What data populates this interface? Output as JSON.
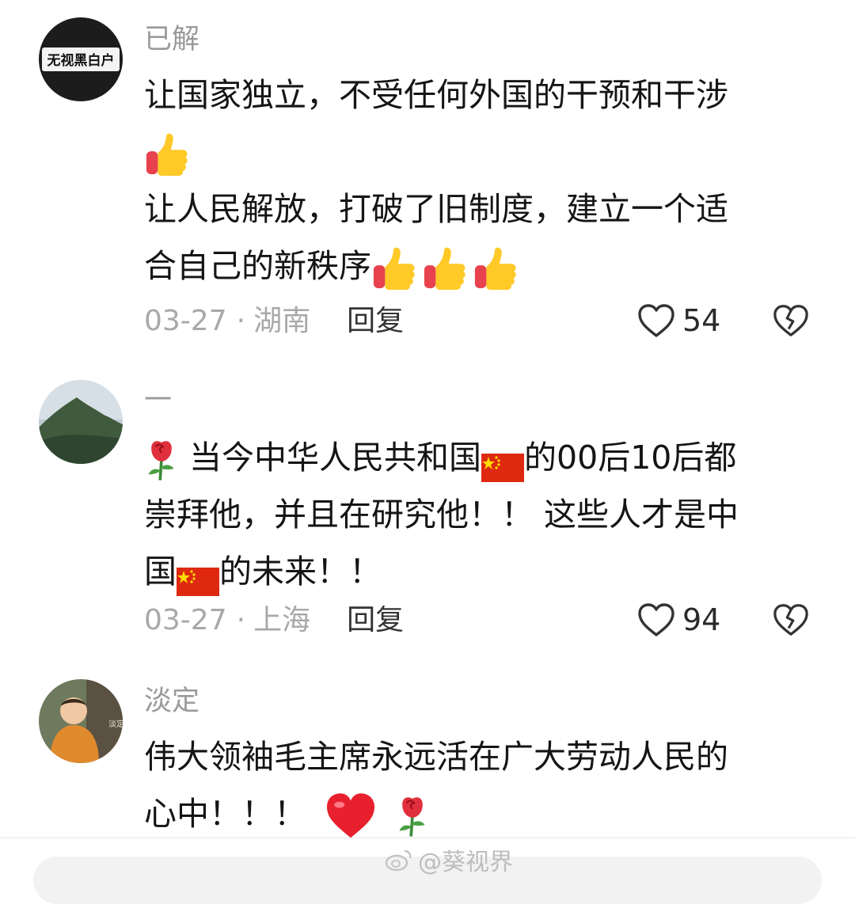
{
  "comments": [
    {
      "username": "已解",
      "avatar_text": "无视黑白户",
      "lines": [
        "让国家独立，不受任何外国的干预和干涉",
        "让人民解放，打破了旧制度，建立一个适",
        "合自己的新秩序"
      ],
      "date": "03-27",
      "location": "湖南",
      "reply_label": "回复",
      "likes": "54"
    },
    {
      "username": "一",
      "text_a": "当今中华人民共和国",
      "text_b": "的00后10后都",
      "line2": "崇拜他，并且在研究他！！ 这些人才是中",
      "text_c": "国",
      "text_d": "的未来！！",
      "date": "03-27",
      "location": "上海",
      "reply_label": "回复",
      "likes": "94"
    },
    {
      "username": "淡定",
      "line1": "伟大领袖毛主席永远活在广大劳动人民的",
      "line2": "心中！！！",
      "avatar_text": "淡定"
    }
  ],
  "watermark": "@葵视界",
  "icons": {
    "thumb": "thumbs-up-icon",
    "rose": "rose-icon",
    "flag": "china-flag-icon",
    "heart": "red-heart-icon",
    "like": "heart-outline-icon",
    "dislike": "broken-heart-icon"
  },
  "colors": {
    "username": "#9a9a9a",
    "text": "#151515",
    "meta": "#a8a8a8",
    "flag_red": "#de2910",
    "flag_star": "#ffde00"
  }
}
